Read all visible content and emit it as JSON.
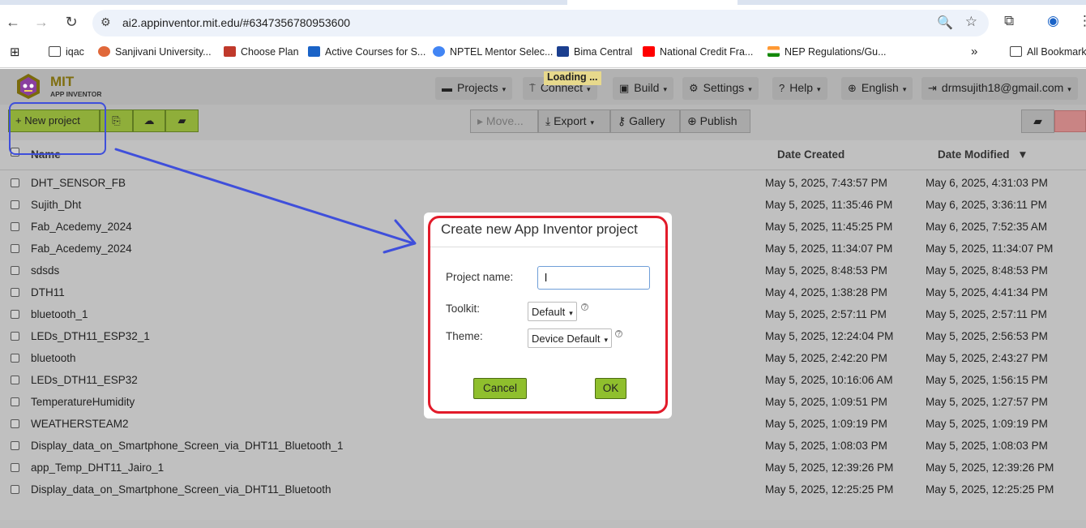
{
  "browser": {
    "url": "ai2.appinventor.mit.edu/#6347356780953600",
    "bookmarks": [
      {
        "label": "iqac",
        "icon": "folder-icon",
        "color": "#444444"
      },
      {
        "label": "Sanjivani University...",
        "icon": "sanjivani-icon",
        "color": "#e0683a"
      },
      {
        "label": "Choose Plan",
        "icon": "m-logo-icon",
        "color": "#c0392b"
      },
      {
        "label": "Active Courses for S...",
        "icon": "s-logo-icon",
        "color": "#1a63c7"
      },
      {
        "label": "NPTEL Mentor Selec...",
        "icon": "google-icon",
        "color": "#4285f4"
      },
      {
        "label": "Bima Central",
        "icon": "bima-icon",
        "color": "#1b3f8f"
      },
      {
        "label": "National Credit Fra...",
        "icon": "youtube-icon",
        "color": "#ff0000"
      },
      {
        "label": "NEP Regulations/Gu...",
        "icon": "india-flag-icon",
        "color": "#ff9933"
      }
    ],
    "all_bookmarks": "All Bookmark"
  },
  "app": {
    "logo": {
      "mit": "MIT",
      "subtitle": "APP INVENTOR"
    },
    "loading": "Loading ...",
    "menu": {
      "projects": "Projects",
      "connect": "Connect",
      "build": "Build",
      "settings": "Settings",
      "help": "Help",
      "language": "English",
      "account": "drmsujith18@gmail.com"
    },
    "toolbar": {
      "new_project": "New project",
      "move": "Move...",
      "export": "Export",
      "gallery": "Gallery",
      "publish": "Publish"
    },
    "table": {
      "headers": {
        "name": "Name",
        "date_created": "Date Created",
        "date_modified": "Date Modified"
      },
      "sort_indicator": "▼",
      "rows": [
        {
          "name": "DHT_SENSOR_FB",
          "created": "May 5, 2025, 7:43:57 PM",
          "modified": "May 6, 2025, 4:31:03 PM"
        },
        {
          "name": "Sujith_Dht",
          "created": "May 5, 2025, 11:35:46 PM",
          "modified": "May 6, 2025, 3:36:11 PM"
        },
        {
          "name": "Fab_Acedemy_2024",
          "created": "May 5, 2025, 11:45:25 PM",
          "modified": "May 6, 2025, 7:52:35 AM"
        },
        {
          "name": "Fab_Acedemy_2024",
          "created": "May 5, 2025, 11:34:07 PM",
          "modified": "May 5, 2025, 11:34:07 PM"
        },
        {
          "name": "sdsds",
          "created": "May 5, 2025, 8:48:53 PM",
          "modified": "May 5, 2025, 8:48:53 PM"
        },
        {
          "name": "DTH11",
          "created": "May 4, 2025, 1:38:28 PM",
          "modified": "May 5, 2025, 4:41:34 PM"
        },
        {
          "name": "bluetooth_1",
          "created": "May 5, 2025, 2:57:11 PM",
          "modified": "May 5, 2025, 2:57:11 PM"
        },
        {
          "name": "LEDs_DTH11_ESP32_1",
          "created": "May 5, 2025, 12:24:04 PM",
          "modified": "May 5, 2025, 2:56:53 PM"
        },
        {
          "name": "bluetooth",
          "created": "May 5, 2025, 2:42:20 PM",
          "modified": "May 5, 2025, 2:43:27 PM"
        },
        {
          "name": "LEDs_DTH11_ESP32",
          "created": "May 5, 2025, 10:16:06 AM",
          "modified": "May 5, 2025, 1:56:15 PM"
        },
        {
          "name": "TemperatureHumidity",
          "created": "May 5, 2025, 1:09:51 PM",
          "modified": "May 5, 2025, 1:27:57 PM"
        },
        {
          "name": "WEATHERSTEAM2",
          "created": "May 5, 2025, 1:09:19 PM",
          "modified": "May 5, 2025, 1:09:19 PM"
        },
        {
          "name": "Display_data_on_Smartphone_Screen_via_DHT11_Bluetooth_1",
          "created": "May 5, 2025, 1:08:03 PM",
          "modified": "May 5, 2025, 1:08:03 PM"
        },
        {
          "name": "app_Temp_DHT11_Jairo_1",
          "created": "May 5, 2025, 12:39:26 PM",
          "modified": "May 5, 2025, 12:39:26 PM"
        },
        {
          "name": "Display_data_on_Smartphone_Screen_via_DHT11_Bluetooth",
          "created": "May 5, 2025, 12:25:25 PM",
          "modified": "May 5, 2025, 12:25:25 PM"
        }
      ]
    }
  },
  "dialog": {
    "title": "Create new App Inventor project",
    "project_name_label": "Project name:",
    "project_name_value": "l",
    "toolkit_label": "Toolkit:",
    "toolkit_value": "Default",
    "theme_label": "Theme:",
    "theme_value": "Device Default",
    "cancel": "Cancel",
    "ok": "OK"
  },
  "colors": {
    "annotation_blue": "#3f4fdb",
    "annotation_red": "#e21b2a",
    "button_green": "#8fbf2d"
  }
}
